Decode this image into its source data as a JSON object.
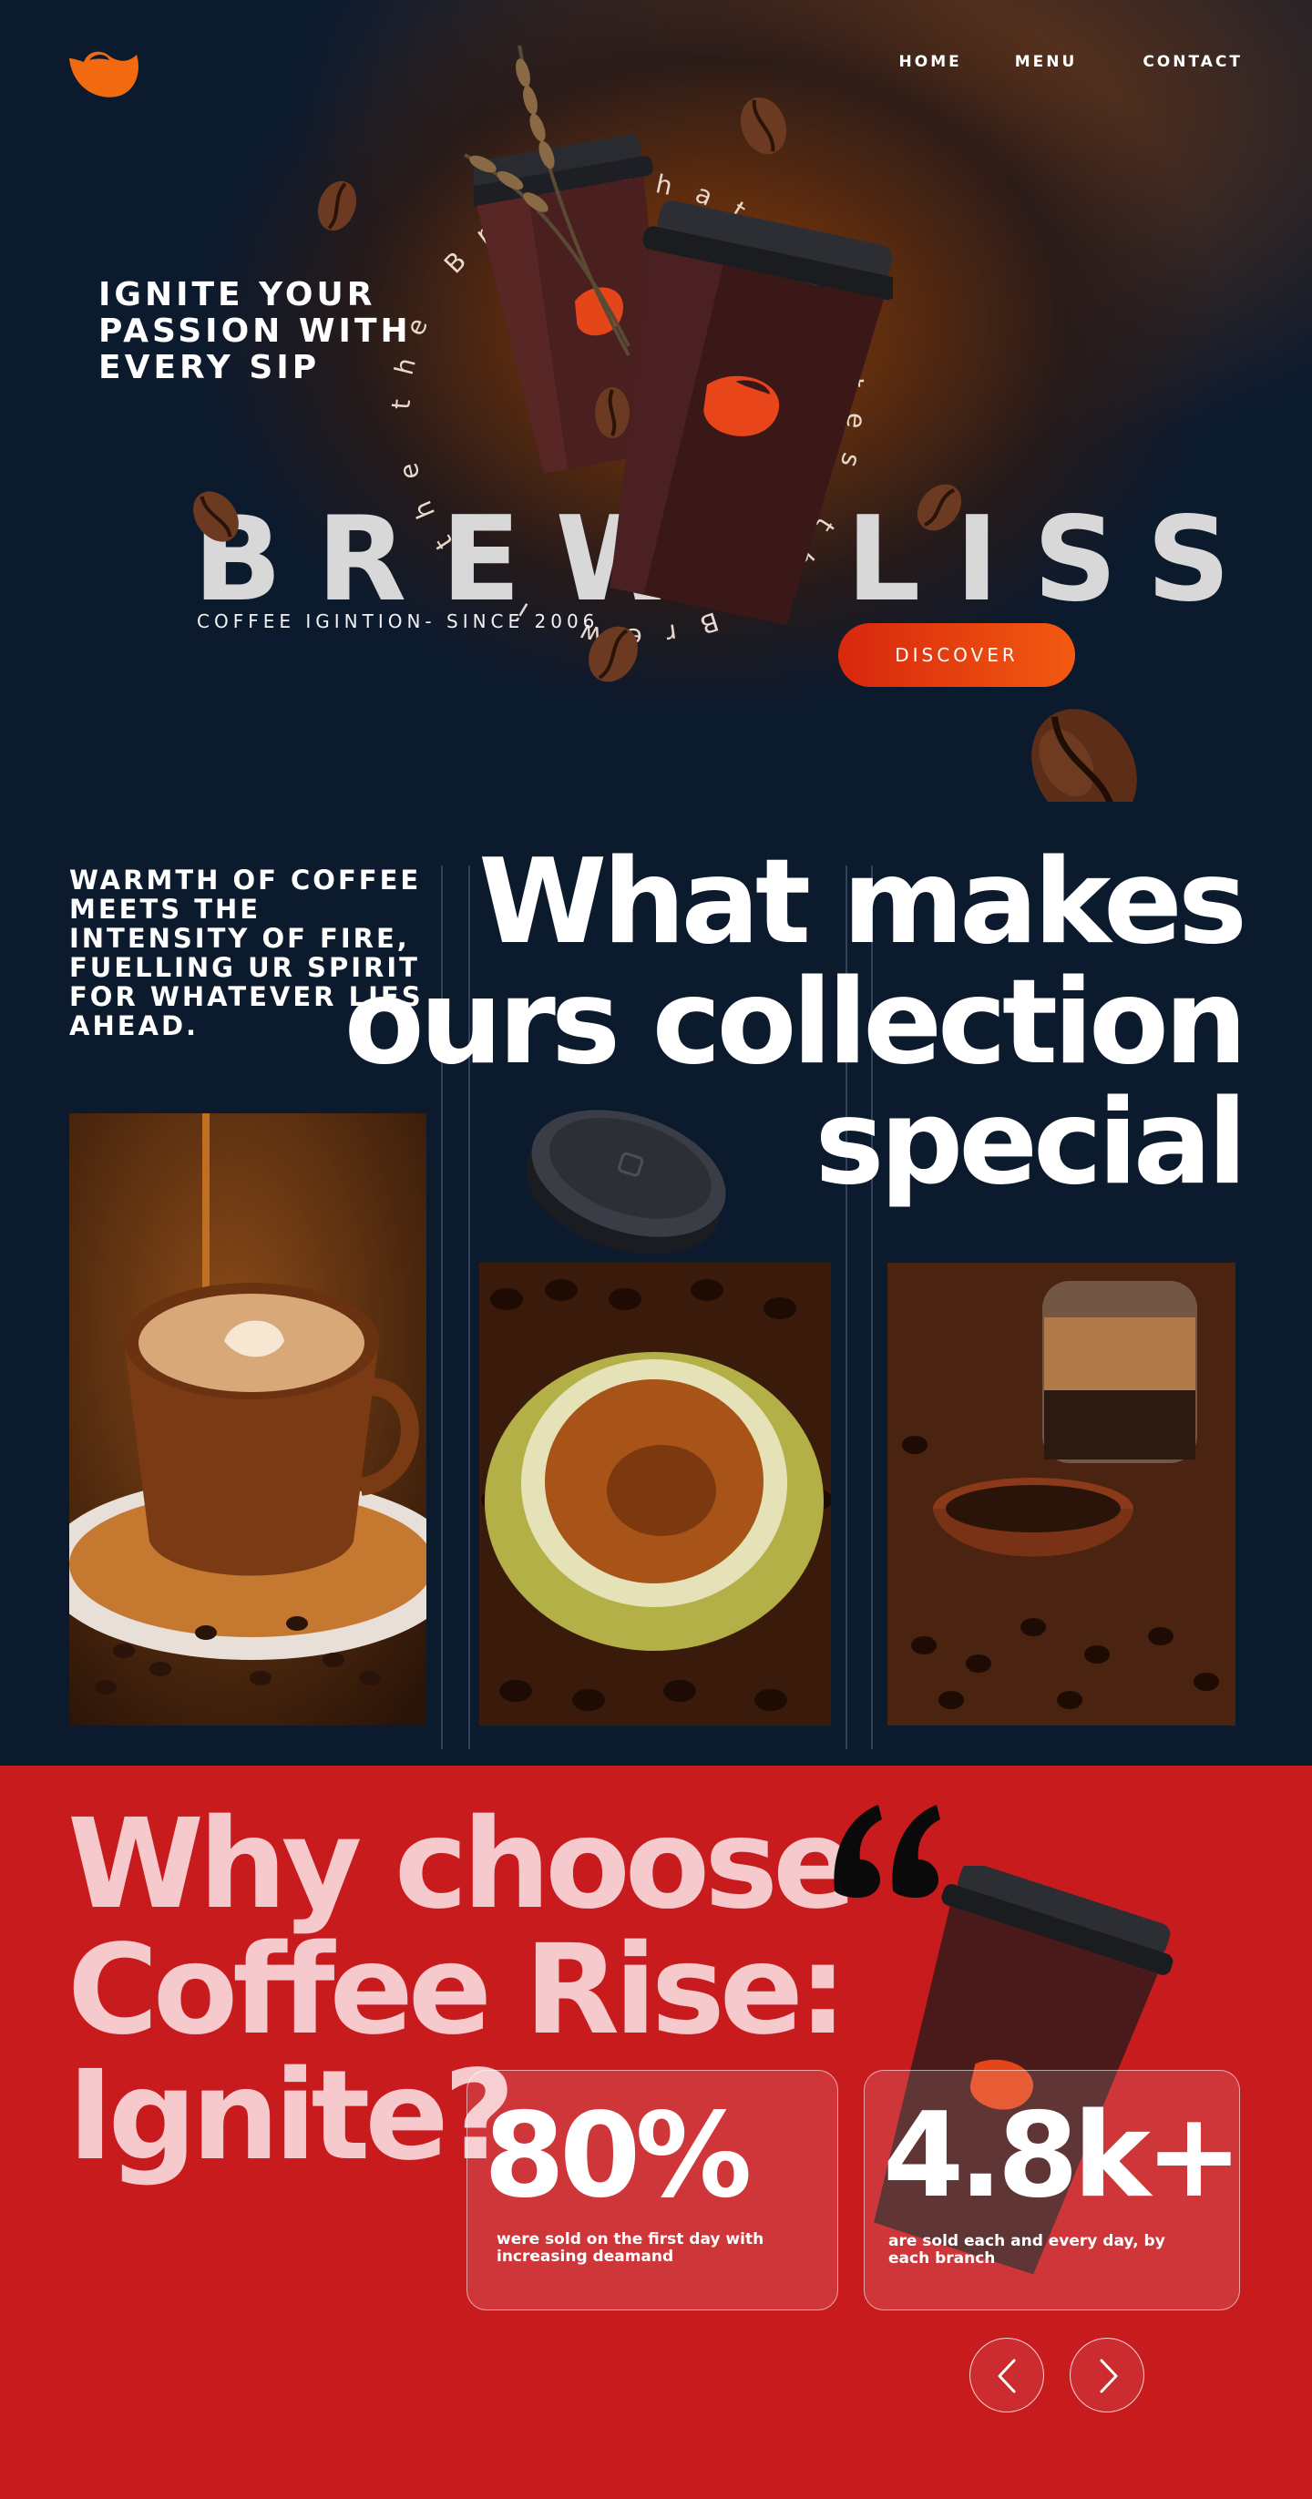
{
  "nav": {
    "items": [
      {
        "label": "HOME"
      },
      {
        "label": "MENU"
      },
      {
        "label": "CONTACT"
      }
    ]
  },
  "hero": {
    "tagline": "IGNITE YOUR PASSION WITH EVERY SIP",
    "brand_left": "BREW",
    "brand_right": "LISS",
    "since": "COFFEE IGINTION- SINCE 2006",
    "ring_text": "the Brew that ignites the Brew is the ",
    "discover_label": "DISCOVER"
  },
  "collection": {
    "intro": "WARMTH OF COFFEE MEETS THE INTENSITY OF FIRE, FUELLING UR SPIRIT FOR WHATEVER LIES AHEAD.",
    "headline": "What makes ours collection special"
  },
  "why": {
    "title": "Why choose Coffee Rise: Ignite?",
    "stats": [
      {
        "value": "80%",
        "description": "were sold on the first day with increasing deamand"
      },
      {
        "value": "4.8k+",
        "description": "are sold each and every day, by each branch"
      }
    ]
  },
  "colors": {
    "accent_orange": "#f25a10",
    "brand_red": "#c81b1e",
    "navy": "#0c1a2e",
    "title_pink": "#f6c9cd"
  },
  "icons": [
    "logo-icon",
    "quote-icon",
    "chevron-left-icon",
    "chevron-right-icon"
  ]
}
